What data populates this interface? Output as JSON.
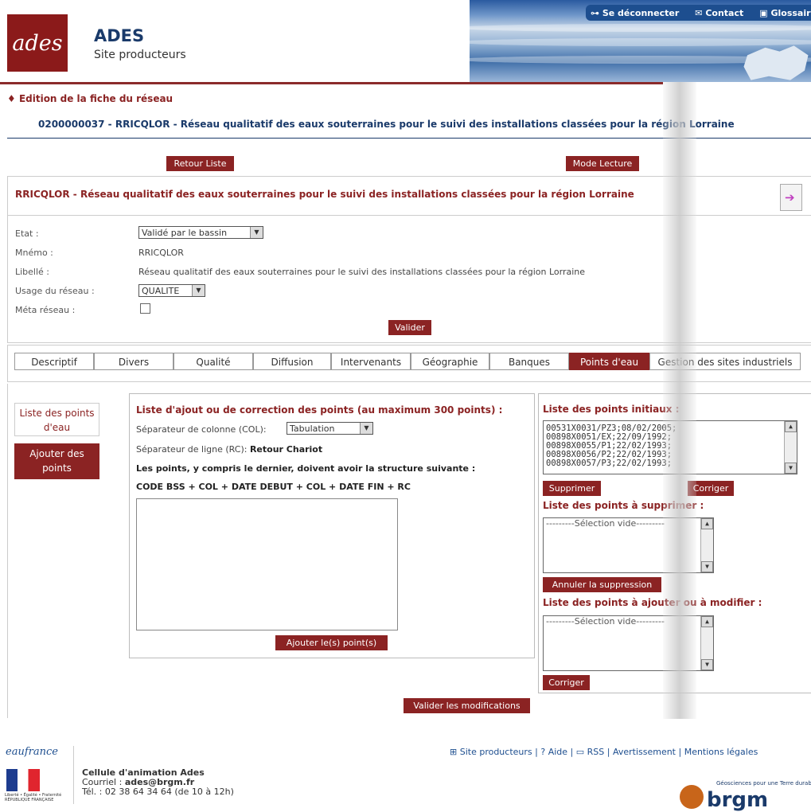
{
  "header": {
    "logo_text": "ades",
    "title": "ADES",
    "subtitle": "Site producteurs",
    "topnav": [
      "Se déconnecter",
      "Contact",
      "Glossaire"
    ]
  },
  "page": {
    "section_title": "Edition de la fiche du réseau",
    "network_title": "0200000037 - RRICQLOR - Réseau qualitatif des eaux souterraines pour le suivi des installations classées pour la région Lorraine",
    "buttons": {
      "back": "Retour Liste",
      "read_mode": "Mode Lecture"
    }
  },
  "card": {
    "title": "RRICQLOR - Réseau qualitatif des eaux souterraines pour le suivi des installations classées pour la région Lorraine",
    "fields": {
      "etat_label": "Etat :",
      "etat_value": "Validé par le bassin",
      "mnemo_label": "Mnémo :",
      "mnemo_value": "RRICQLOR",
      "libelle_label": "Libellé :",
      "libelle_value": "Réseau qualitatif des eaux souterraines pour le suivi des installations classées pour la région Lorraine",
      "usage_label": "Usage du réseau :",
      "usage_value": "QUALITE",
      "meta_label": "Méta réseau :"
    },
    "validate": "Valider"
  },
  "tabs": [
    "Descriptif",
    "Divers",
    "Qualité",
    "Diffusion",
    "Intervenants",
    "Géographie",
    "Banques",
    "Points d'eau",
    "Gestion des sites industriels"
  ],
  "active_tab": "Points d'eau",
  "sidebar": {
    "link": "Liste des points d'eau",
    "button": "Ajouter des points"
  },
  "center": {
    "title": "Liste d'ajout ou de correction des points (au maximum 300 points) :",
    "col_sep_label": "Séparateur de colonne (COL):",
    "col_sep_value": "Tabulation",
    "row_sep_label": "Séparateur de ligne (RC):",
    "row_sep_value": "Retour Chariot",
    "structure_note": "Les points, y compris le dernier, doivent avoir la structure suivante :",
    "structure": "CODE BSS + COL + DATE DEBUT + COL + DATE FIN + RC",
    "add_button": "Ajouter le(s) point(s)"
  },
  "right": {
    "initial_title": "Liste des points initiaux :",
    "initial_items": [
      "00531X0031/PZ3;08/02/2005;",
      "00898X0051/EX;22/09/1992;",
      "00898X0055/P1;22/02/1993;",
      "00898X0056/P2;22/02/1993;",
      "00898X0057/P3;22/02/1993;"
    ],
    "delete_button": "Supprimer",
    "correct_button": "Corriger",
    "to_delete_title": "Liste des points à supprimer :",
    "empty_selection": "---------Sélection vide---------",
    "cancel_delete_button": "Annuler la suppression",
    "to_add_title": "Liste des points à ajouter ou à modifier :",
    "correct_button2": "Corriger"
  },
  "submit": "Valider les modifications",
  "footer": {
    "eaufrance": "eaufrance",
    "republique": "Liberté • Égalité • Fraternité RÉPUBLIQUE FRANÇAISE",
    "cell_title": "Cellule d'animation Ades",
    "cell_mail_label": "Courriel :",
    "cell_mail": "ades@brgm.fr",
    "cell_tel": "Tél. : 02 38 64 34 64 (de 10 à 12h)",
    "links": [
      "Site producteurs",
      "Aide",
      "RSS",
      "Avertissement",
      "Mentions légales"
    ],
    "brgm": "brgm",
    "brgm_tagline": "Géosciences pour une Terre durable"
  },
  "colors": {
    "accent": "#8b2323",
    "brand_blue": "#1a3a6a"
  }
}
